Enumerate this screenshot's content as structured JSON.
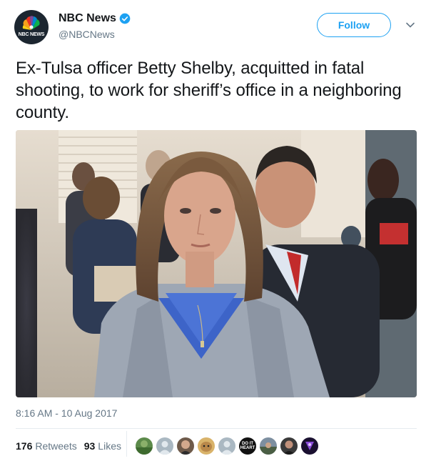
{
  "account": {
    "display_name": "NBC News",
    "handle": "@NBCNews",
    "avatar_text": "NBC NEWS",
    "verified": true
  },
  "follow_label": "Follow",
  "tweet": {
    "text": "Ex-Tulsa officer Betty Shelby, acquitted in fatal shooting, to work for sheriff’s office in a neighboring county."
  },
  "timestamp": "8:16 AM - 10 Aug 2017",
  "stats": {
    "retweets_count": "176",
    "retweets_label": "Retweets",
    "likes_count": "93",
    "likes_label": "Likes"
  },
  "likers": [
    {
      "icon": "landscape-avatar"
    },
    {
      "icon": "default-avatar"
    },
    {
      "icon": "person-avatar"
    },
    {
      "icon": "cat-avatar"
    },
    {
      "icon": "default-avatar"
    },
    {
      "icon": "do-it-logo-avatar",
      "text": "DO IT\nHEART"
    },
    {
      "icon": "outdoor-avatar"
    },
    {
      "icon": "person-avatar"
    },
    {
      "icon": "purple-avatar"
    }
  ],
  "colors": {
    "accent": "#1da1f2",
    "text": "#14171a",
    "secondary_text": "#657786",
    "divider": "#e6ecf0"
  }
}
